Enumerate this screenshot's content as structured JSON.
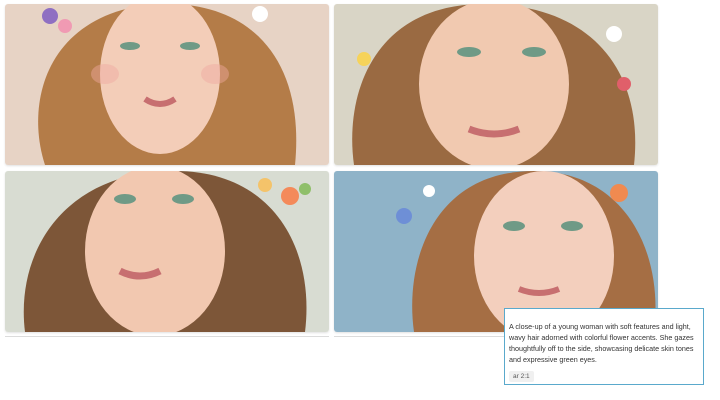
{
  "gallery": {
    "images": [
      {
        "subject": "portrait-woman-flower-crown",
        "bg": "#e7d3c5",
        "hair": "#b47c48",
        "skin": "#f3cdb8",
        "flowers": [
          "#8f6fc2",
          "#f09ab3",
          "#ffffff"
        ]
      },
      {
        "subject": "portrait-woman-flower-crown",
        "bg": "#d9d5c6",
        "hair": "#9a6a42",
        "skin": "#f1c9b0",
        "flowers": [
          "#f6d35a",
          "#ffffff",
          "#e05f6a"
        ]
      },
      {
        "subject": "portrait-woman-flower-crown",
        "bg": "#d8dcd2",
        "hair": "#7d5638",
        "skin": "#f2c8b0",
        "flowers": [
          "#f48a5a",
          "#f4c36a",
          "#8fbf6a"
        ]
      },
      {
        "subject": "portrait-woman-flower-crown",
        "bg": "#8fb3c8",
        "hair": "#a56e44",
        "skin": "#f3cfbd",
        "flowers": [
          "#6e8fd6",
          "#f08a50",
          "#ffffff"
        ]
      }
    ]
  },
  "caption": {
    "text": "A close-up of a young woman with soft features and light, wavy hair adorned with colorful flower accents. She gazes thoughtfully off to the side, showcasing delicate skin tones and expressive green eyes.",
    "ratio": "ar 2:1"
  },
  "colors": {
    "caption_border": "#5aa9cc",
    "divider": "#dcdcdc"
  }
}
